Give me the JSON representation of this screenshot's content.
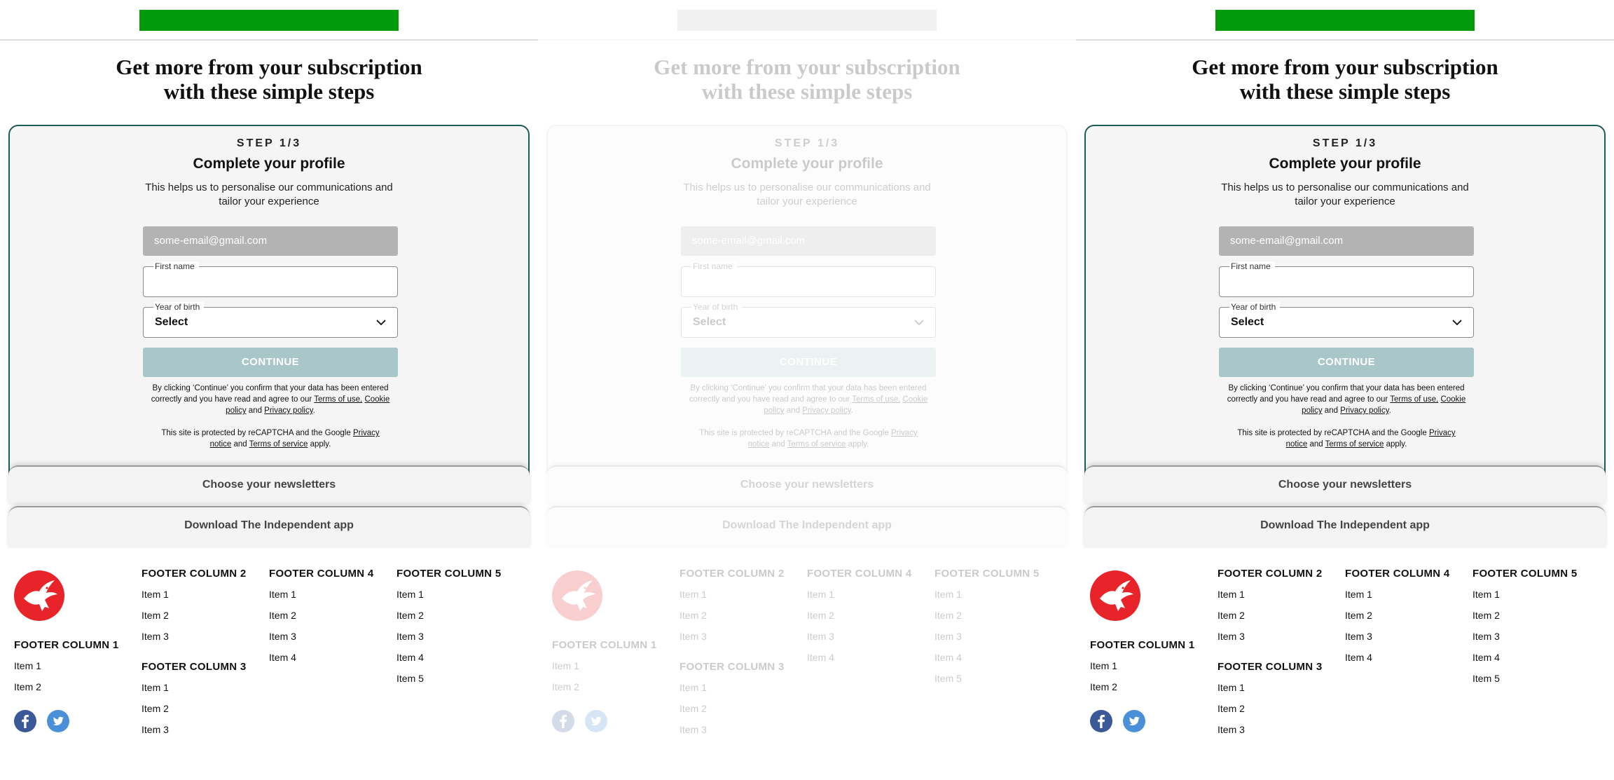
{
  "colors": {
    "brand_green": "#009a0a",
    "card_border": "#1b5e55",
    "continue_disabled": "#a9c6c8",
    "email_bg": "#b3b3b3",
    "logo_red": "#e8232a",
    "facebook_blue": "#3b5998",
    "twitter_blue": "#4a90d9"
  },
  "panels": [
    {
      "state": "normal"
    },
    {
      "state": "faded"
    },
    {
      "state": "normal"
    }
  ],
  "headline": {
    "line1": "Get more from your subscription",
    "line2": "with these simple steps"
  },
  "card": {
    "step": "STEP 1/3",
    "title": "Complete your profile",
    "description": "This helps us to personalise our communications and tailor your experience",
    "email_value": "some-email@gmail.com",
    "first_name_label": "First name",
    "first_name_value": "",
    "year_label": "Year of birth",
    "year_value": "Select",
    "continue_label": "CONTINUE",
    "legal": {
      "p1_a": "By clicking ‘Continue’ you confirm that your data has been entered correctly and you have read and agree to our ",
      "terms_link": "Terms of use,",
      "cookie_link": "Cookie policy",
      "p1_and": " and ",
      "privacy_link": "Privacy policy",
      "p1_end": ".",
      "p2_a": "This site is protected by reCAPTCHA and the Google ",
      "privacy_notice_link": "Privacy notice",
      "p2_and": " and ",
      "tos_link": "Terms of service",
      "p2_end": " apply."
    }
  },
  "accordions": {
    "newsletters": "Choose your newsletters",
    "app": "Download The Independent app"
  },
  "footer": {
    "logo_icon": "eagle-logo",
    "columns": {
      "c1": {
        "title": "FOOTER COLUMN 1",
        "items": [
          "Item 1",
          "Item 2"
        ]
      },
      "c2": {
        "title": "FOOTER COLUMN 2",
        "items": [
          "Item 1",
          "Item 2",
          "Item 3"
        ]
      },
      "c3": {
        "title": "FOOTER COLUMN 3",
        "items": [
          "Item 1",
          "Item 2",
          "Item 3"
        ]
      },
      "c4": {
        "title": "FOOTER COLUMN 4",
        "items": [
          "Item 1",
          "Item 2",
          "Item 3",
          "Item 4"
        ]
      },
      "c5": {
        "title": "FOOTER COLUMN 5",
        "items": [
          "Item 1",
          "Item 2",
          "Item 3",
          "Item 4",
          "Item 5"
        ]
      }
    },
    "social": [
      "facebook-icon",
      "twitter-icon"
    ]
  }
}
